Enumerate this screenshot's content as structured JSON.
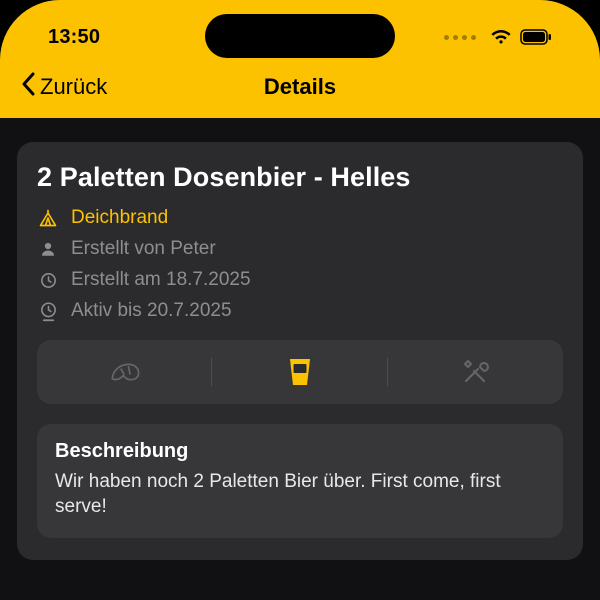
{
  "statusbar": {
    "time": "13:50"
  },
  "nav": {
    "back": "Zurück",
    "title": "Details"
  },
  "item": {
    "title": "2 Paletten Dosenbier - Helles",
    "venue": "Deichbrand",
    "created_by": "Erstellt von Peter",
    "created_at": "Erstellt am 18.7.2025",
    "active_until": "Aktiv bis 20.7.2025"
  },
  "segments": {
    "food": "food",
    "drink": "drink",
    "tools": "tools",
    "active": "drink"
  },
  "description": {
    "heading": "Beschreibung",
    "body": "Wir haben noch 2 Paletten Bier über. First come, first serve!"
  }
}
